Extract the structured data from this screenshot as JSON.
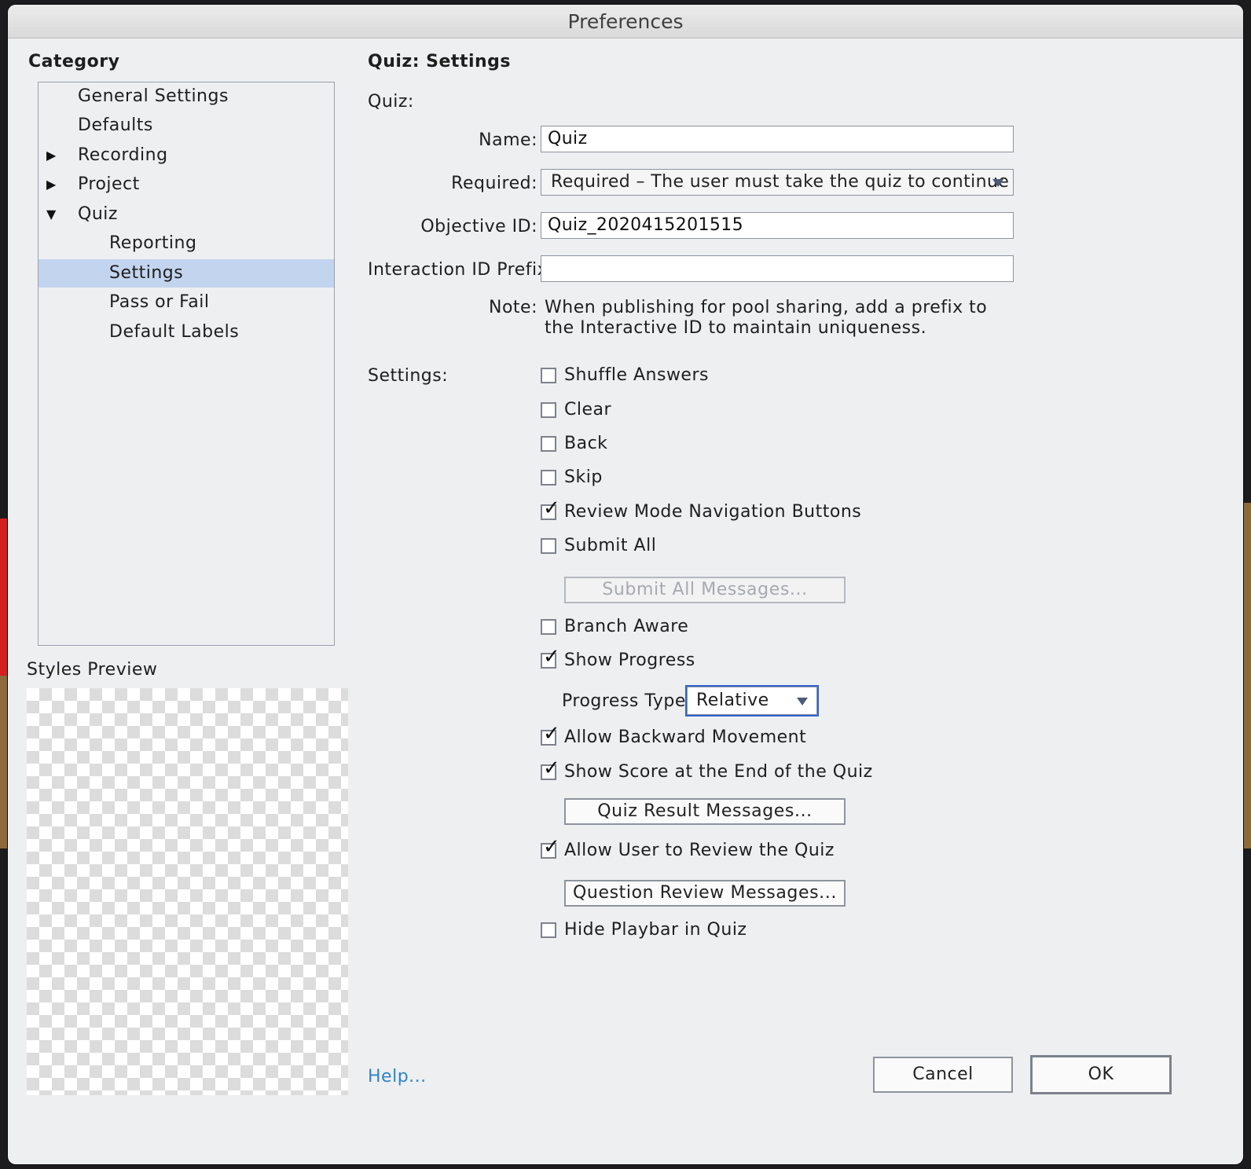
{
  "window": {
    "title": "Preferences"
  },
  "left": {
    "category_label": "Category",
    "tree": [
      {
        "label": "General Settings",
        "arrow": "",
        "level": 0,
        "selected": false
      },
      {
        "label": "Defaults",
        "arrow": "",
        "level": 0,
        "selected": false
      },
      {
        "label": "Recording",
        "arrow": "▶",
        "level": 0,
        "selected": false
      },
      {
        "label": "Project",
        "arrow": "▶",
        "level": 0,
        "selected": false
      },
      {
        "label": "Quiz",
        "arrow": "▼",
        "level": 0,
        "selected": false
      },
      {
        "label": "Reporting",
        "arrow": "",
        "level": 1,
        "selected": false
      },
      {
        "label": "Settings",
        "arrow": "",
        "level": 1,
        "selected": true
      },
      {
        "label": "Pass or Fail",
        "arrow": "",
        "level": 1,
        "selected": false
      },
      {
        "label": "Default Labels",
        "arrow": "",
        "level": 1,
        "selected": false
      }
    ],
    "styles_preview_label": "Styles Preview"
  },
  "main": {
    "section_title": "Quiz: Settings",
    "quiz_label": "Quiz:",
    "name_label": "Name:",
    "name_value": "Quiz",
    "required_label": "Required:",
    "required_value": "Required – The user must take the quiz to continue",
    "objective_label": "Objective ID:",
    "objective_value": "Quiz_2020415201515",
    "interaction_label": "Interaction ID Prefix:",
    "interaction_value": "",
    "note_label": "Note:",
    "note_line1": "When publishing for pool sharing, add a prefix to",
    "note_line2": "the Interactive ID to maintain uniqueness.",
    "settings_label": "Settings:",
    "checkboxes": {
      "shuffle_answers": {
        "label": "Shuffle Answers",
        "checked": false
      },
      "clear": {
        "label": "Clear",
        "checked": false
      },
      "back": {
        "label": "Back",
        "checked": false
      },
      "skip": {
        "label": "Skip",
        "checked": false
      },
      "review_mode_nav": {
        "label": "Review Mode Navigation Buttons",
        "checked": true
      },
      "submit_all": {
        "label": "Submit All",
        "checked": false
      },
      "branch_aware": {
        "label": "Branch Aware",
        "checked": false
      },
      "show_progress": {
        "label": "Show Progress",
        "checked": true
      },
      "allow_backward": {
        "label": "Allow Backward Movement",
        "checked": true
      },
      "show_score": {
        "label": "Show Score at the End of the Quiz",
        "checked": true
      },
      "allow_review": {
        "label": "Allow User to Review the Quiz",
        "checked": true
      },
      "hide_playbar": {
        "label": "Hide Playbar in Quiz",
        "checked": false
      }
    },
    "submit_all_messages_label": "Submit All Messages...",
    "progress_type_label": "Progress Type:",
    "progress_type_value": "Relative",
    "quiz_result_messages_label": "Quiz Result Messages...",
    "question_review_messages_label": "Question Review Messages..."
  },
  "footer": {
    "help_label": "Help...",
    "cancel_label": "Cancel",
    "ok_label": "OK"
  },
  "colors": {
    "selection": "#c2d4ee",
    "focus_ring": "#2f63d0",
    "link": "#2f84c4"
  }
}
